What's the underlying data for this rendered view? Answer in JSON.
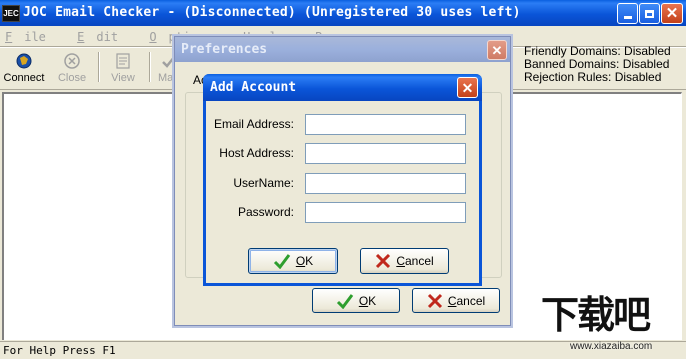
{
  "main_window": {
    "app_icon_text": "JEC",
    "title": "JOC Email Checker - (Disconnected) (Unregistered 30 uses left)",
    "controls": [
      "minimize",
      "maximize",
      "close"
    ]
  },
  "menu": [
    {
      "hotkey": "F",
      "rest": "ile"
    },
    {
      "hotkey": "E",
      "rest": "dit"
    },
    {
      "hotkey": "O",
      "rest": "ptions"
    },
    {
      "hotkey": "H",
      "rest": "elp"
    },
    {
      "hotkey": "R",
      "rest": "e"
    }
  ],
  "toolbar": {
    "connect": "Connect",
    "close": "Close",
    "view": "View",
    "partial": "Ma"
  },
  "status_panel": {
    "friendly_domains": "Friendly Domains: Disabled",
    "banned_domains": "Banned Domains: Disabled",
    "rejection_rules": "Rejection Rules: Disabled"
  },
  "statusbar": {
    "text": "For Help Press F1"
  },
  "preferences_dialog": {
    "title": "Preferences",
    "group_label_partial": "Ac",
    "ok_button": {
      "hotkey": "O",
      "rest": "K"
    },
    "cancel_button": {
      "hotkey": "C",
      "rest": "ancel"
    }
  },
  "add_account_dialog": {
    "title": "Add Account",
    "fields": {
      "email_label": "Email Address:",
      "email_value": "",
      "host_label": "Host Address:",
      "host_value": "",
      "username_label": "UserName:",
      "username_value": "",
      "password_label": "Password:",
      "password_value": ""
    },
    "ok_button": {
      "hotkey": "O",
      "rest": "K"
    },
    "cancel_button": {
      "hotkey": "C",
      "rest": "ancel"
    }
  },
  "watermark": {
    "text": "下载吧",
    "url": "www.xiazaiba.com"
  },
  "colors": {
    "xp_blue": "#0a55d8",
    "window_face": "#ece9d8",
    "ok_check": "#2e9e2e",
    "cancel_x": "#c0281c"
  }
}
